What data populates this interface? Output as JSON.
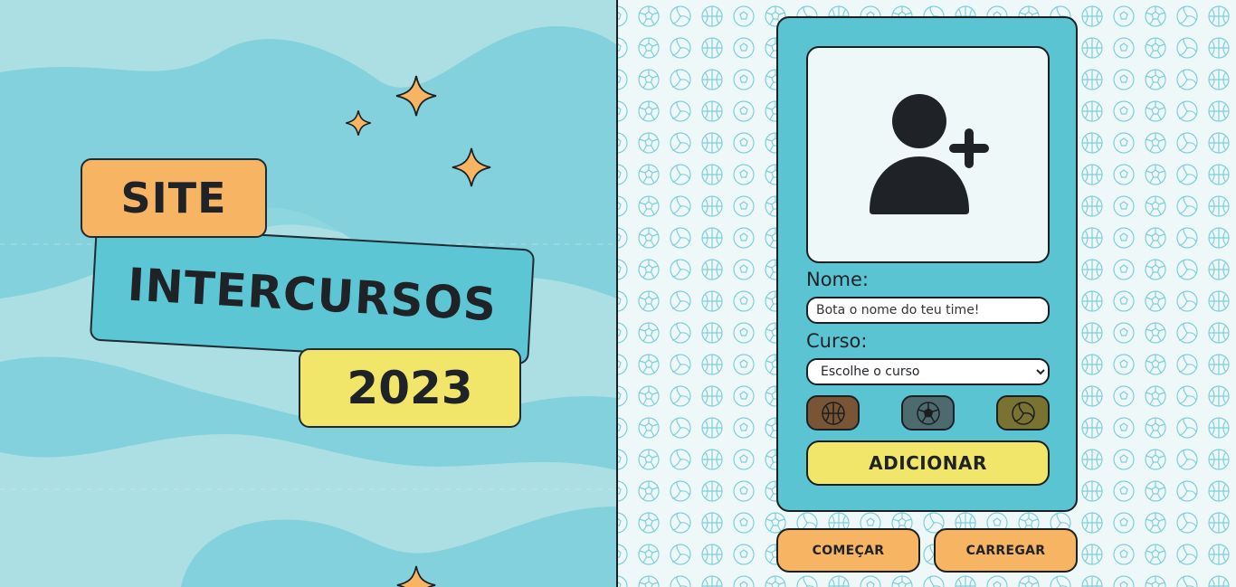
{
  "banner": {
    "line1": "SITE",
    "line2": "INTERCURSOS",
    "line3": "2023"
  },
  "form": {
    "avatar_icon": "add-user-icon",
    "name_label": "Nome:",
    "name_placeholder": "Bota o nome do teu time!",
    "course_label": "Curso:",
    "course_selected": "Escolhe o curso",
    "sport_buttons": [
      {
        "icon": "basketball-icon",
        "color": "#7a5535"
      },
      {
        "icon": "soccer-ball-icon",
        "color": "#4d6b6e"
      },
      {
        "icon": "volleyball-icon",
        "color": "#7a7230"
      }
    ],
    "add_label": "ADICIONAR"
  },
  "actions": {
    "start_label": "COMEÇAR",
    "load_label": "CARREGAR"
  },
  "colors": {
    "orange": "#f7b463",
    "teal": "#5bc4d3",
    "yellow": "#f1e56a",
    "dark": "#1b1f22"
  }
}
